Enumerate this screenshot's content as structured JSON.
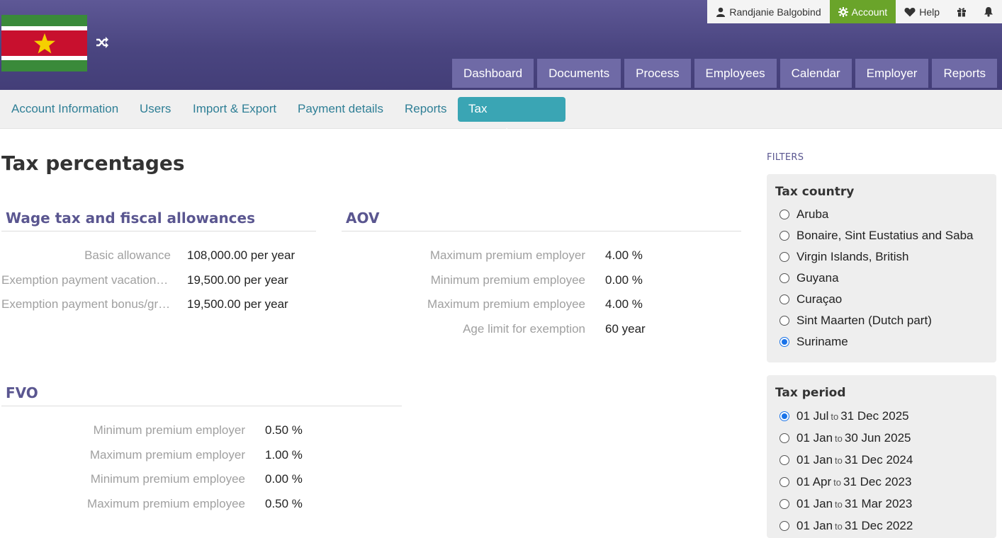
{
  "topbar": {
    "user_label": "Randjanie Balgobind",
    "account_label": "Account",
    "help_label": "Help",
    "accent_color": "#6aa42a"
  },
  "main_nav": [
    "Dashboard",
    "Documents",
    "Process",
    "Employees",
    "Calendar",
    "Employer",
    "Reports"
  ],
  "sub_nav": {
    "items": [
      "Account Information",
      "Users",
      "Import & Export",
      "Payment details",
      "Reports",
      "Tax percentages"
    ],
    "active": "Tax percentages"
  },
  "page_title": "Tax percentages",
  "wage_tax": {
    "title": "Wage tax and fiscal allowances",
    "rows": [
      {
        "label": "Basic allowance",
        "value": "108,000.00 per year"
      },
      {
        "label": "Exemption payment vacation allowance",
        "value": "19,500.00 per year"
      },
      {
        "label": "Exemption payment bonus/gratuity",
        "value": "19,500.00 per year"
      }
    ]
  },
  "aov": {
    "title": "AOV",
    "rows": [
      {
        "label": "Maximum premium employer",
        "value": "4.00 %"
      },
      {
        "label": "Minimum premium employee",
        "value": "0.00 %"
      },
      {
        "label": "Maximum premium employee",
        "value": "4.00 %"
      },
      {
        "label": "Age limit for exemption",
        "value": "60 year"
      }
    ]
  },
  "fvo": {
    "title": "FVO",
    "rows": [
      {
        "label": "Minimum premium employer",
        "value": "0.50 %"
      },
      {
        "label": "Maximum premium employer",
        "value": "1.00 %"
      },
      {
        "label": "Minimum premium employee",
        "value": "0.00 %"
      },
      {
        "label": "Maximum premium employee",
        "value": "0.50 %"
      }
    ]
  },
  "filters": {
    "heading": "FILTERS",
    "tax_country": {
      "title": "Tax country",
      "options": [
        "Aruba",
        "Bonaire, Sint Eustatius and Saba",
        "Virgin Islands, British",
        "Guyana",
        "Curaçao",
        "Sint Maarten (Dutch part)",
        "Suriname"
      ],
      "selected": "Suriname"
    },
    "tax_period": {
      "title": "Tax period",
      "to_word": "to",
      "options": [
        {
          "from": "01 Jul",
          "to": "31 Dec 2025"
        },
        {
          "from": "01 Jan",
          "to": "30 Jun 2025"
        },
        {
          "from": "01 Jan",
          "to": "31 Dec 2024"
        },
        {
          "from": "01 Apr",
          "to": "31 Dec 2023"
        },
        {
          "from": "01 Jan",
          "to": "31 Mar 2023"
        },
        {
          "from": "01 Jan",
          "to": "31 Dec 2022"
        }
      ],
      "selected_index": 0
    }
  }
}
